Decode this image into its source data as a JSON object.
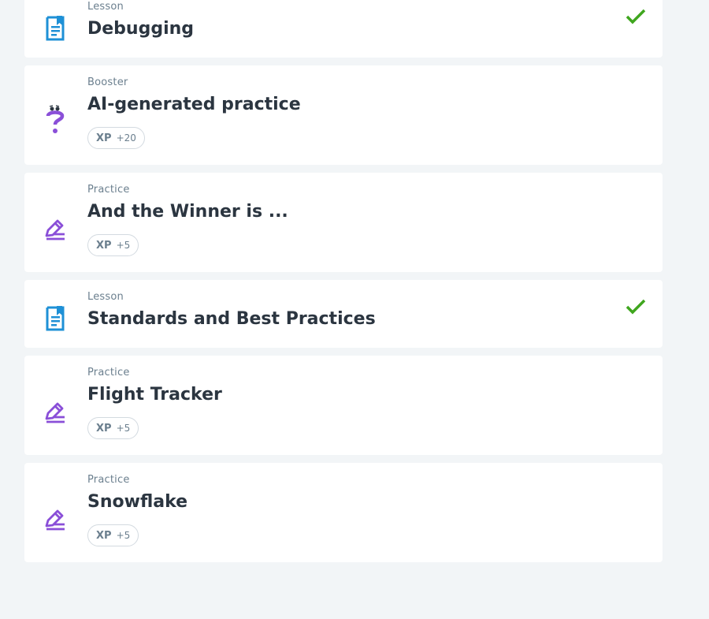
{
  "items": [
    {
      "kind": "Lesson",
      "title": "Debugging",
      "icon": "lesson-icon",
      "completed": true
    },
    {
      "kind": "Booster",
      "title": "AI-generated practice",
      "icon": "booster-question-icon",
      "xp_label": "XP",
      "xp_value": "+20"
    },
    {
      "kind": "Practice",
      "title": "And the Winner is ...",
      "icon": "practice-pencil-icon",
      "xp_label": "XP",
      "xp_value": "+5"
    },
    {
      "kind": "Lesson",
      "title": "Standards and Best Practices",
      "icon": "lesson-icon",
      "completed": true
    },
    {
      "kind": "Practice",
      "title": "Flight Tracker",
      "icon": "practice-pencil-icon",
      "xp_label": "XP",
      "xp_value": "+5"
    },
    {
      "kind": "Practice",
      "title": "Snowflake",
      "icon": "practice-pencil-icon",
      "xp_label": "XP",
      "xp_value": "+5"
    }
  ],
  "colors": {
    "lesson": "#1e90d6",
    "practice": "#8a4fd8",
    "check": "#3fa61e"
  }
}
